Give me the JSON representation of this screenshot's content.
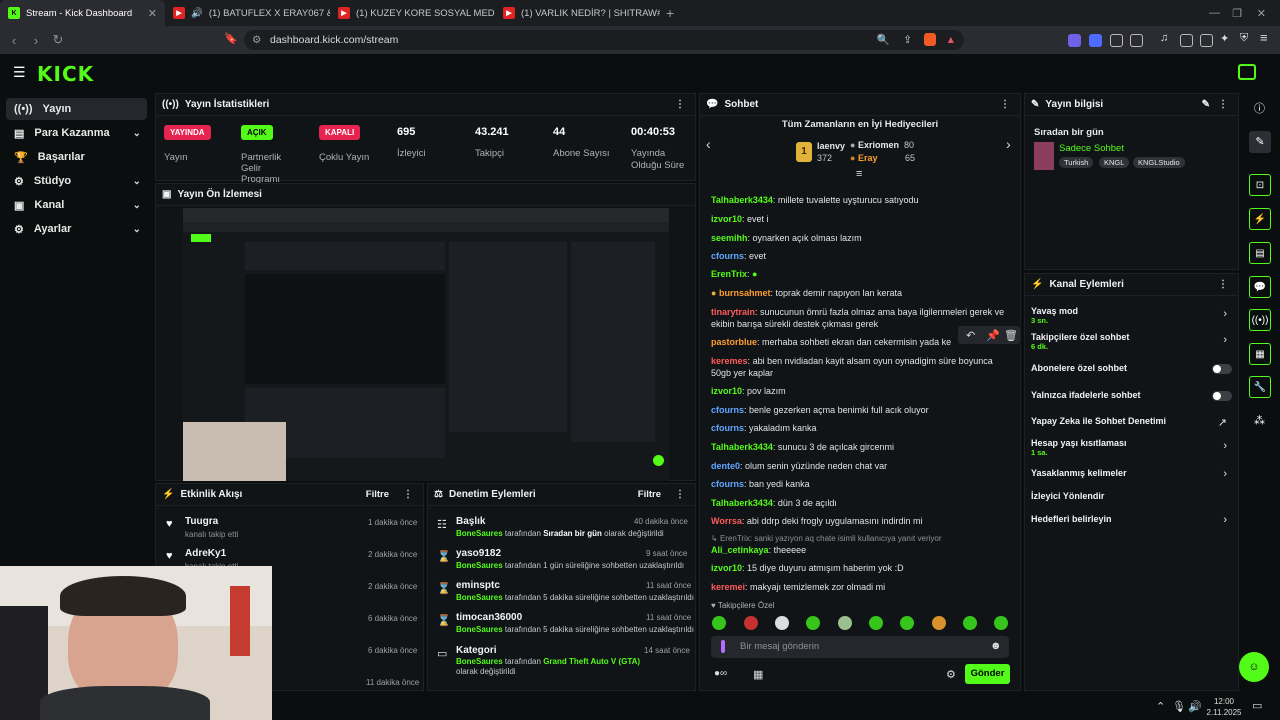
{
  "browser": {
    "tabs": [
      {
        "title": "Stream - Kick Dashboard",
        "icon": "kick"
      },
      {
        "title": "(1) BATUFLEX X ERAY067 & MAN",
        "icon": "youtube"
      },
      {
        "title": "(1) KUZEY KORE SOSYAL MEDYASINE",
        "icon": "youtube"
      },
      {
        "title": "(1) VARLIK NEDİR? | SHITRAW#8 - Yo",
        "icon": "youtube"
      }
    ],
    "url": "dashboard.kick.com/stream"
  },
  "sidebar": {
    "items": [
      {
        "label": "Yayın",
        "icon": "broadcast-icon",
        "expandable": false
      },
      {
        "label": "Para Kazanma",
        "icon": "money-icon",
        "expandable": true
      },
      {
        "label": "Başarılar",
        "icon": "trophy-icon",
        "expandable": false
      },
      {
        "label": "Stüdyo",
        "icon": "studio-icon",
        "expandable": true
      },
      {
        "label": "Kanal",
        "icon": "channel-icon",
        "expandable": true
      },
      {
        "label": "Ayarlar",
        "icon": "settings-icon",
        "expandable": true
      }
    ]
  },
  "stats": {
    "title": "Yayın İstatistikleri",
    "items": [
      {
        "badge": "YAYINDA",
        "label": "Yayın",
        "badge_color": "#e5254f"
      },
      {
        "badge": "AÇIK",
        "label": "Partnerlik Gelir Programı",
        "badge_color": "#53fc18"
      },
      {
        "badge": "KAPALI",
        "label": "Çoklu Yayın",
        "badge_color": "#e5254f"
      },
      {
        "value": "695",
        "label": "İzleyici"
      },
      {
        "value": "43.241",
        "label": "Takipçi"
      },
      {
        "value": "44",
        "label": "Abone Sayısı"
      },
      {
        "value": "00:40:53",
        "label": "Yayında Olduğu Süre"
      }
    ]
  },
  "preview": {
    "title": "Yayın Ön İzlemesi"
  },
  "activity": {
    "title": "Etkinlik Akışı",
    "filter": "Filtre",
    "rows": [
      {
        "name": "Tuugra",
        "sub": "kanalı takip etti",
        "time": "1 dakika önce"
      },
      {
        "name": "AdreKy1",
        "sub": "kanalı takip etti",
        "time": "2 dakika önce"
      },
      {
        "time": "2 dakika önce"
      },
      {
        "time": "6 dakika önce"
      },
      {
        "time": "6 dakika önce"
      },
      {
        "time": "11 dakika önce"
      }
    ]
  },
  "moderation": {
    "title": "Denetim Eylemleri",
    "filter": "Filtre",
    "rows": [
      {
        "title": "Başlık",
        "user": "BoneSaures",
        "text": "tarafından",
        "highlight": "Sıradan bir gün",
        "tail": "olarak değiştirildi",
        "time": "40 dakika önce"
      },
      {
        "title": "yaso9182",
        "user": "BoneSaures",
        "text": "tarafından 1 gün süreliğine sohbetten uzaklaştırıldı",
        "time": "9 saat önce"
      },
      {
        "title": "eminsptc",
        "user": "BoneSaures",
        "text": "tarafından 5 dakika süreliğine sohbetten uzaklaştırıldı",
        "time": "11 saat önce"
      },
      {
        "title": "timocan36000",
        "user": "BoneSaures",
        "text": "tarafından 5 dakika süreliğine sohbetten uzaklaştırıldı",
        "time": "11 saat önce"
      },
      {
        "title": "Kategori",
        "user": "BoneSaures",
        "text": "tarafından",
        "highlight": "Grand Theft Auto V (GTA)",
        "tail": "olarak değiştirildi",
        "time": "14 saat önce"
      }
    ]
  },
  "chat": {
    "title": "Sohbet",
    "gifters_title": "Tüm Zamanların en İyi Hediyecileri",
    "top": {
      "name": "laenvy",
      "amount": "372"
    },
    "gifters": [
      {
        "name": "Exriomen",
        "amount": "80"
      },
      {
        "name": "Eray",
        "amount": "65"
      }
    ],
    "messages": [
      {
        "user": "Talhaberk3434",
        "color": "#53fc18",
        "text": "millete tuvalette uyşturucu satıyodu"
      },
      {
        "user": "izvor10",
        "color": "#53fc18",
        "text": "evet i"
      },
      {
        "user": "seemihh",
        "color": "#53fc18",
        "text": "oynarken açık olması lazım"
      },
      {
        "user": "cfourns",
        "color": "#5fa8ff",
        "text": "evet"
      },
      {
        "user": "ErenTrix",
        "color": "#53fc18",
        "text": ""
      },
      {
        "user": "burnsahmet",
        "color": "#ff9d2e",
        "text": "toprak demir napıyon lan kerata"
      },
      {
        "user": "tinarytrain",
        "color": "#ff5a5a",
        "text": "sunucunun ömrü fazla olmaz ama baya ilgilenmeleri gerek ve ekibin barışa sürekli destek çıkması gerek"
      },
      {
        "user": "pastorblue",
        "color": "#ff9d2e",
        "text": "merhaba sohbeti ekran dan cekermisin yada kendini"
      },
      {
        "user": "keremes",
        "color": "#ff5a5a",
        "text": "abi ben nvidiadan kayit alsam oyun oynadigim süre boyunca 50gb yer kaplar"
      },
      {
        "user": "izvor10",
        "color": "#53fc18",
        "text": "pov lazım"
      },
      {
        "user": "cfourns",
        "color": "#5fa8ff",
        "text": "benle gezerken açma benimki full acık oluyor"
      },
      {
        "user": "cfourns",
        "color": "#5fa8ff",
        "text": "yakaladım kanka"
      },
      {
        "user": "Talhaberk3434",
        "color": "#53fc18",
        "text": "sunucu 3 de açılcak gircenmi"
      },
      {
        "user": "dente0",
        "color": "#5fa8ff",
        "text": "olum senin yüzünde neden chat var"
      },
      {
        "user": "cfourns",
        "color": "#5fa8ff",
        "text": "ban yedi kanka"
      },
      {
        "user": "Talhaberk3434",
        "color": "#53fc18",
        "text": "dün 3 de açıldı"
      },
      {
        "user": "Worrsa",
        "color": "#ff5a5a",
        "text": "abi ddrp deki frogly uygulamasını indirdin mi"
      },
      {
        "reply": "ErenTrix: sanki yazıyon aq chate isimli kullanıcıya yanıt veriyor",
        "user": "Ali_cetinkaya",
        "color": "#53fc18",
        "text": "theeeee"
      },
      {
        "user": "izvor10",
        "color": "#53fc18",
        "text": "15 diye duyuru atmışım haberim yok :D"
      },
      {
        "user": "keremei",
        "color": "#ff5a5a",
        "text": "makyajı temizlemek zor olmadi mi"
      }
    ],
    "followers_only": "Takipçilere Özel",
    "placeholder": "Bir mesaj gönderin",
    "send": "Gönder"
  },
  "info": {
    "title": "Yayın bilgisi",
    "stream_title": "Sıradan bir gün",
    "category": "Sadece Sohbet",
    "tags": [
      "Turkish",
      "KNGL",
      "KNGLStudio"
    ]
  },
  "channel_actions": {
    "title": "Kanal Eylemleri",
    "items": [
      {
        "label": "Yavaş mod",
        "sub": "3 sn.",
        "control": "chevron"
      },
      {
        "label": "Takipçilere özel sohbet",
        "sub": "6 dk.",
        "control": "chevron"
      },
      {
        "label": "Abonelere özel sohbet",
        "sub": "",
        "control": "toggle"
      },
      {
        "label": "Yalnızca ifadelerle sohbet",
        "sub": "",
        "control": "toggle"
      },
      {
        "label": "Yapay Zeka ile Sohbet Denetimi",
        "sub": "",
        "control": "external"
      },
      {
        "label": "Hesap yaşı kısıtlaması",
        "sub": "1 sa.",
        "control": "chevron"
      },
      {
        "label": "Yasaklanmış kelimeler",
        "sub": "",
        "control": "chevron"
      },
      {
        "label": "İzleyici Yönlendir",
        "sub": "",
        "control": "none"
      },
      {
        "label": "Hedefleri belirleyin",
        "sub": "",
        "control": "chevron"
      }
    ]
  },
  "taskbar": {
    "time": "12:00",
    "date": "2.11.2025"
  },
  "colors": {
    "accent": "#53fc18",
    "live": "#e5254f",
    "panel": "#111417"
  }
}
